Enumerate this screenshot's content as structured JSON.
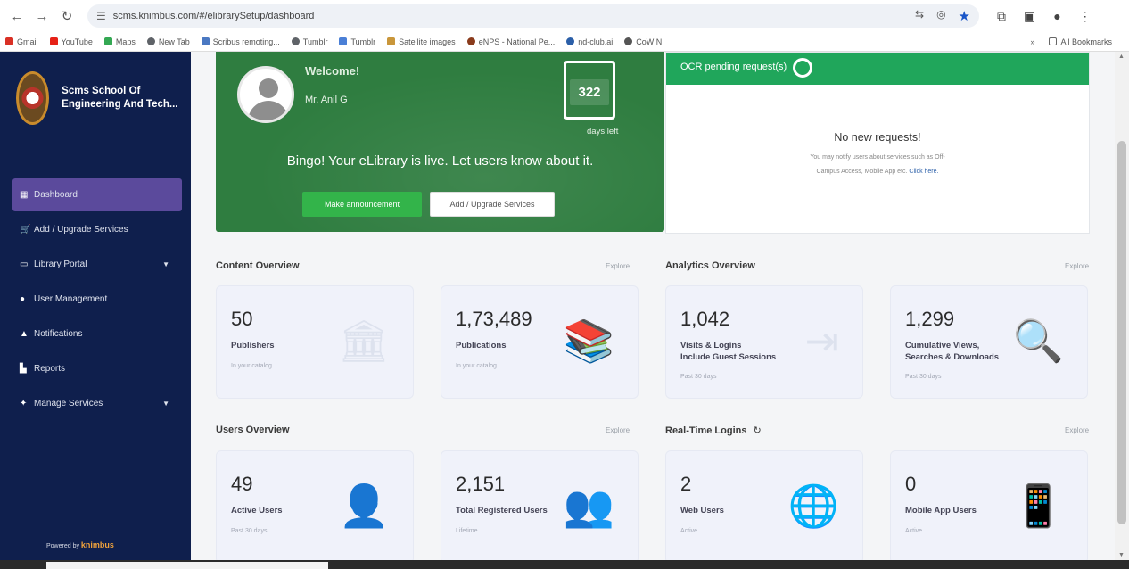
{
  "browser": {
    "url": "scms.knimbus.com/#/elibrarySetup/dashboard",
    "bookmarks": [
      "Gmail",
      "YouTube",
      "Maps",
      "New Tab",
      "Scribus remoting...",
      "Tumblr",
      "Tumblr",
      "Satellite images",
      "eNPS - National Pe...",
      "nd-club.ai",
      "CoWIN"
    ],
    "all_bookmarks": "All Bookmarks"
  },
  "sidebar": {
    "brand_name": "Scms School Of Engineering And Tech...",
    "items": [
      {
        "label": "Dashboard",
        "icon": "grid-icon",
        "active": true
      },
      {
        "label": "Add / Upgrade Services",
        "icon": "cart-icon"
      },
      {
        "label": "Library Portal",
        "icon": "monitor-icon",
        "has_caret": true
      },
      {
        "label": "User Management",
        "icon": "user-icon"
      },
      {
        "label": "Notifications",
        "icon": "bell-icon"
      },
      {
        "label": "Reports",
        "icon": "chart-icon"
      },
      {
        "label": "Manage Services",
        "icon": "wrench-icon",
        "has_caret": true
      }
    ],
    "powered_by": "Powered by",
    "powered_brand": "knimbus"
  },
  "welcome": {
    "label": "Welcome!",
    "user_name": "Mr. Anil G",
    "days_count": "322",
    "days_left": "days left",
    "live_message": "Bingo! Your eLibrary is live. Let users know about it.",
    "announce_button": "Make announcement",
    "upgrade_button": "Add / Upgrade Services"
  },
  "requests": {
    "header": "OCR pending request(s)",
    "title": "No new requests!",
    "desc_line1": "You may notify users about services such as Off-",
    "desc_line2": "Campus Access, Mobile App etc.",
    "desc_link": "Click here."
  },
  "content_overview": {
    "title": "Content Overview",
    "explore": "Explore",
    "cards": [
      {
        "number": "50",
        "label": "Publishers",
        "sub": "In your catalog",
        "icon": "institution-icon"
      },
      {
        "number": "1,73,489",
        "label": "Publications",
        "sub": "In your catalog",
        "icon": "books-icon"
      }
    ]
  },
  "analytics_overview": {
    "title": "Analytics Overview",
    "explore": "Explore",
    "cards": [
      {
        "number": "1,042",
        "label": "Visits & Logins",
        "label2": "Include Guest Sessions",
        "sub": "Past 30 days",
        "icon": "sign-in-icon"
      },
      {
        "number": "1,299",
        "label": "Cumulative Views,",
        "label2": "Searches & Downloads",
        "sub": "Past 30 days",
        "icon": "search-download-icon"
      }
    ]
  },
  "users_overview": {
    "title": "Users Overview",
    "explore": "Explore",
    "cards": [
      {
        "number": "49",
        "label": "Active Users",
        "sub": "Past 30 days",
        "icon": "user-icon"
      },
      {
        "number": "2,151",
        "label": "Total Registered Users",
        "sub": "Lifetime",
        "icon": "users-icon"
      }
    ]
  },
  "realtime_logins": {
    "title": "Real-Time Logins",
    "explore": "Explore",
    "cards": [
      {
        "number": "2",
        "label": "Web Users",
        "sub": "Active",
        "icon": "globe-icon"
      },
      {
        "number": "0",
        "label": "Mobile App Users",
        "sub": "Active",
        "icon": "mobile-icon"
      }
    ]
  }
}
